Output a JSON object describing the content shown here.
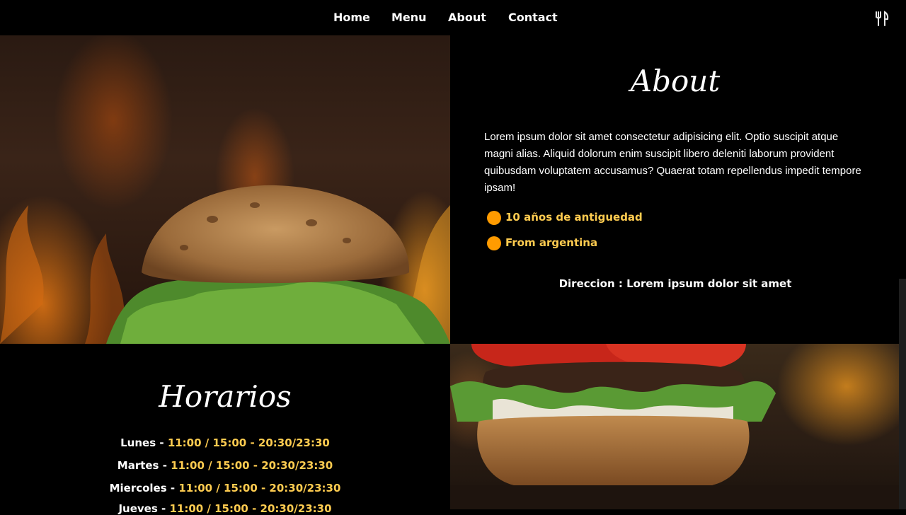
{
  "nav": {
    "links": [
      "Home",
      "Menu",
      "About",
      "Contact"
    ],
    "logo_icon": "fork-knife-icon"
  },
  "about": {
    "title": "About",
    "text": "Lorem ipsum dolor sit amet consectetur adipisicing elit. Optio suscipit atque magni alias. Aliquid dolorum enim suscipit libero deleniti laborum provident quibusdam voluptatem accusamus? Quaerat totam repellendus impedit tempore ipsam!",
    "features": [
      "10 años de antiguedad",
      "From argentina"
    ],
    "address": "Direccion : Lorem ipsum dolor sit amet"
  },
  "hours": {
    "title": "Horarios",
    "rows": [
      {
        "day": "Lunes",
        "times": "11:00 / 15:00 - 20:30/23:30"
      },
      {
        "day": "Martes",
        "times": "11:00 / 15:00 - 20:30/23:30"
      },
      {
        "day": "Miercoles",
        "times": "11:00 / 15:00 - 20:30/23:30"
      },
      {
        "day": "Jueves",
        "times": "11:00 / 15:00 - 20:30/23:30"
      }
    ]
  },
  "colors": {
    "accent": "#ff9b00",
    "highlight_text": "#ffcc50",
    "background": "#000000"
  }
}
